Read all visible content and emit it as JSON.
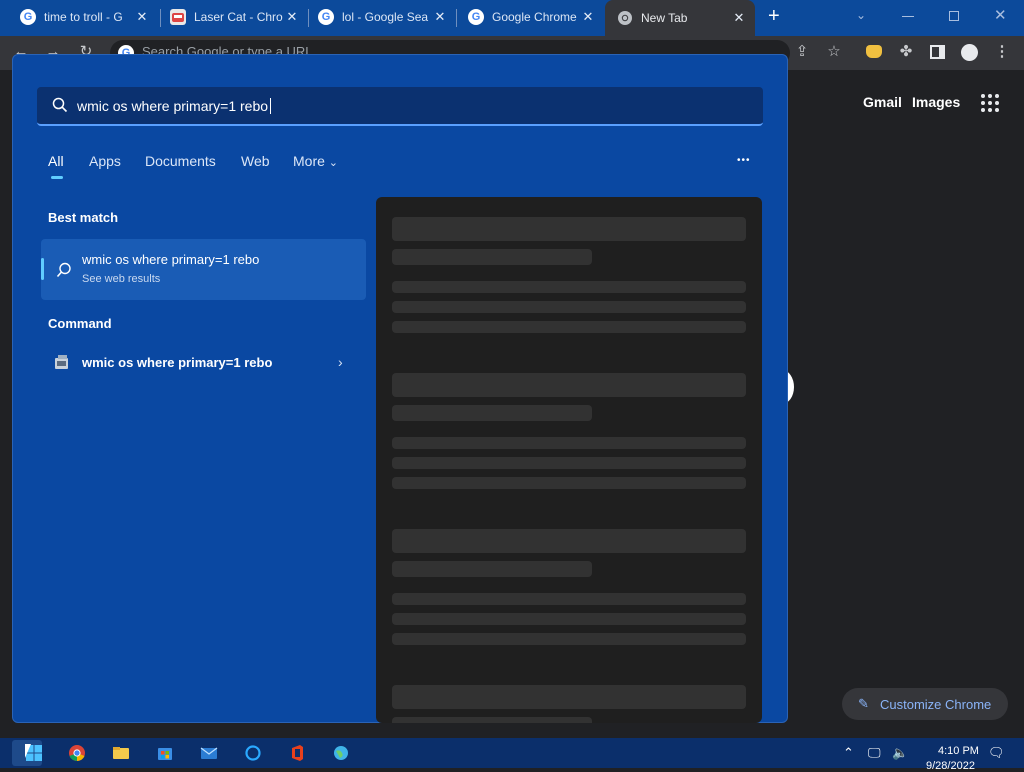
{
  "chrome": {
    "tabs": [
      {
        "title": "time to troll - G",
        "favicon": "google-icon"
      },
      {
        "title": "Laser Cat - Chro",
        "favicon": "cat-icon"
      },
      {
        "title": "lol - Google Sea",
        "favicon": "google-icon"
      },
      {
        "title": "Google Chrome",
        "favicon": "google-icon"
      },
      {
        "title": "New Tab",
        "favicon": "chrome-icon"
      }
    ],
    "new_tab": "+",
    "omnibox_placeholder": "Search Google or type a URL"
  },
  "ntp": {
    "gmail": "Gmail",
    "images": "Images",
    "customize": "Customize Chrome"
  },
  "search": {
    "query": "wmic os where primary=1 rebo",
    "filters": [
      "All",
      "Apps",
      "Documents",
      "Web",
      "More"
    ],
    "more_caret": "⌄",
    "options": "•••",
    "best_match_heading": "Best match",
    "best_match": {
      "title": "wmic os where primary=1 rebo",
      "subtitle": "See web results"
    },
    "command_heading": "Command",
    "command": {
      "title": "wmic os where primary=1 rebo"
    }
  },
  "taskbar": {
    "time": "4:10 PM",
    "date": "9/28/2022"
  },
  "colors": {
    "flyout_bg": "#0a48a2",
    "accent": "#60cdff",
    "preview_bg": "#1f1f1f"
  }
}
